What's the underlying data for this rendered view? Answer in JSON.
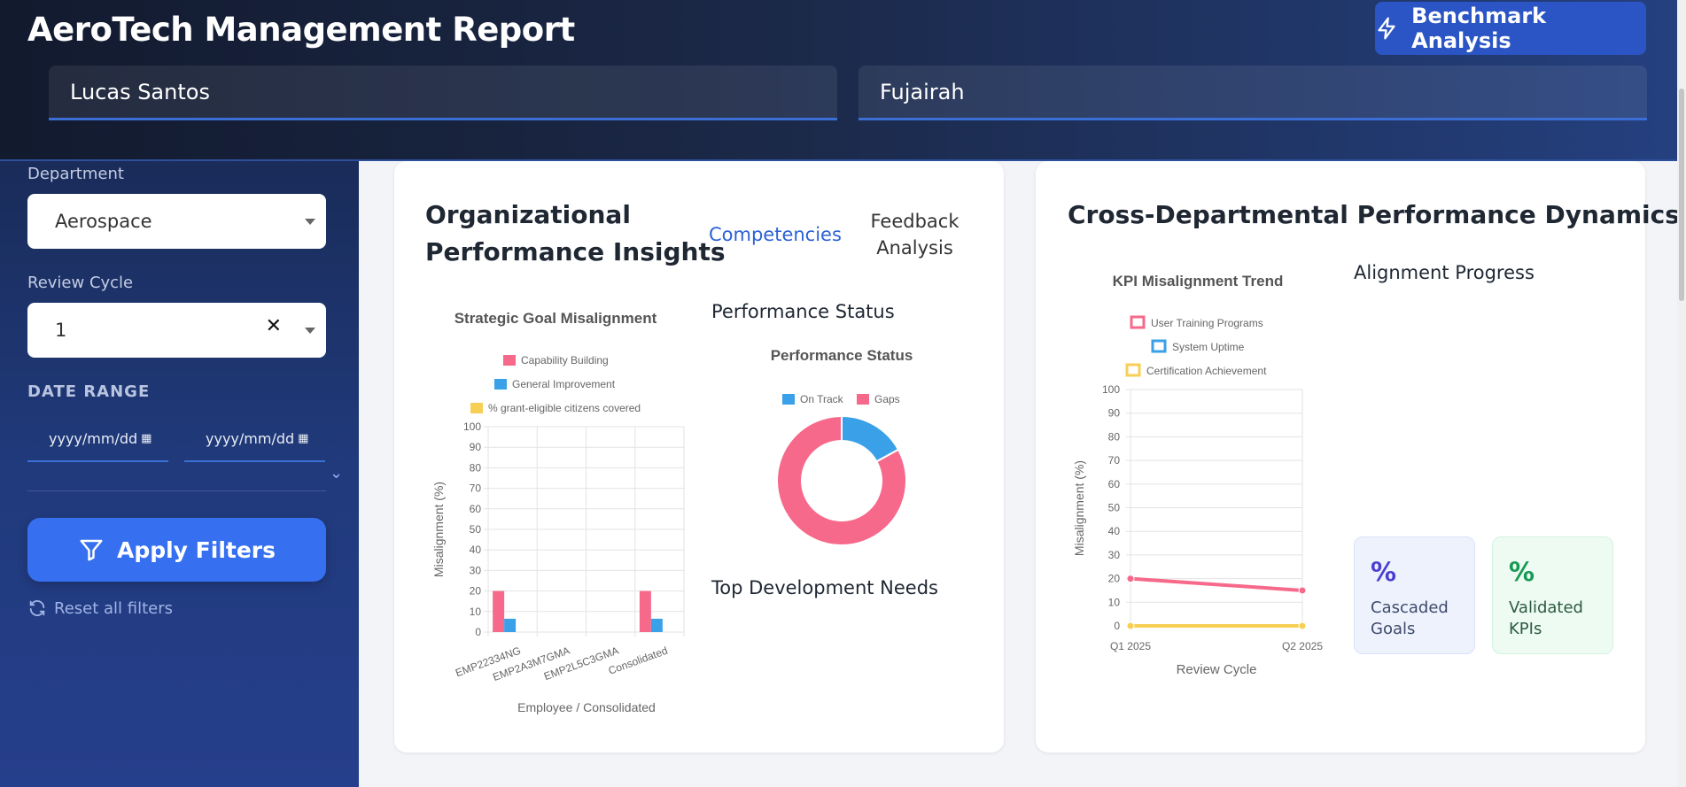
{
  "header": {
    "title": "AeroTech Management Report",
    "benchmark_label": "Benchmark Analysis",
    "employee_name": "Lucas Santos",
    "location": "Fujairah"
  },
  "sidebar": {
    "department_label": "Department",
    "department_value": "Aerospace",
    "review_cycle_label": "Review Cycle",
    "review_cycle_value": "1",
    "date_range_label": "DATE RANGE",
    "date_placeholder_start": "yyyy/mm/dd",
    "date_placeholder_end": "yyyy/mm/dd",
    "apply_label": "Apply Filters",
    "reset_label": "Reset all filters"
  },
  "card1": {
    "title_line1": "Organizational",
    "title_line2": "Performance Insights",
    "tab_active": "Competencies",
    "tab_inactive_line1": "Feedback",
    "tab_inactive_line2": "Analysis",
    "performance_status_heading": "Performance Status",
    "top_needs_heading": "Top Development Needs"
  },
  "card2": {
    "title": "Cross-Departmental Performance Dynamics",
    "alignment_heading": "Alignment Progress",
    "goals_pct": "%",
    "goals_label_line1": "Cascaded",
    "goals_label_line2": "Goals",
    "kpis_pct": "%",
    "kpis_label_line1": "Validated",
    "kpis_label_line2": "KPIs"
  },
  "colors": {
    "pink": "#f7698a",
    "blue": "#3aa0e8",
    "yellow": "#f8cf55",
    "accent": "#2b62d6"
  },
  "chart_data": [
    {
      "type": "bar",
      "title": "Strategic Goal Misalignment",
      "xlabel": "Employee / Consolidated",
      "ylabel": "Misalignment (%)",
      "categories": [
        "EMP22334NG",
        "EMP2A3M7GMA",
        "EMP2L5C3GMA",
        "Consolidated"
      ],
      "ylim": [
        0,
        100
      ],
      "yticks": [
        0,
        10,
        20,
        30,
        40,
        50,
        60,
        70,
        80,
        90,
        100
      ],
      "series": [
        {
          "name": "Capability Building",
          "color": "#f7698a",
          "values": [
            20,
            0,
            0,
            20
          ]
        },
        {
          "name": "General Improvement",
          "color": "#3aa0e8",
          "values": [
            6.5,
            0,
            0,
            6.5
          ]
        },
        {
          "name": "% grant-eligible citizens covered",
          "color": "#f8cf55",
          "values": [
            0,
            0,
            0,
            0
          ]
        }
      ],
      "legend": "top"
    },
    {
      "type": "pie",
      "title": "Performance Status",
      "donut": true,
      "series": [
        {
          "name": "On Track",
          "color": "#3aa0e8",
          "value": 17
        },
        {
          "name": "Gaps",
          "color": "#f7698a",
          "value": 83
        }
      ],
      "legend": "top"
    },
    {
      "type": "line",
      "title": "KPI Misalignment Trend",
      "xlabel": "Review Cycle",
      "ylabel": "Misalignment (%)",
      "x": [
        "Q1 2025",
        "Q2 2025"
      ],
      "ylim": [
        0,
        100
      ],
      "yticks": [
        0,
        10,
        20,
        30,
        40,
        50,
        60,
        70,
        80,
        90,
        100
      ],
      "series": [
        {
          "name": "User Training Programs",
          "color": "#f7698a",
          "values": [
            20,
            15
          ]
        },
        {
          "name": "System Uptime",
          "color": "#3aa0e8",
          "values": [
            0,
            0
          ]
        },
        {
          "name": "Certification Achievement",
          "color": "#f8cf55",
          "values": [
            0,
            0
          ]
        }
      ],
      "legend": "top"
    }
  ]
}
